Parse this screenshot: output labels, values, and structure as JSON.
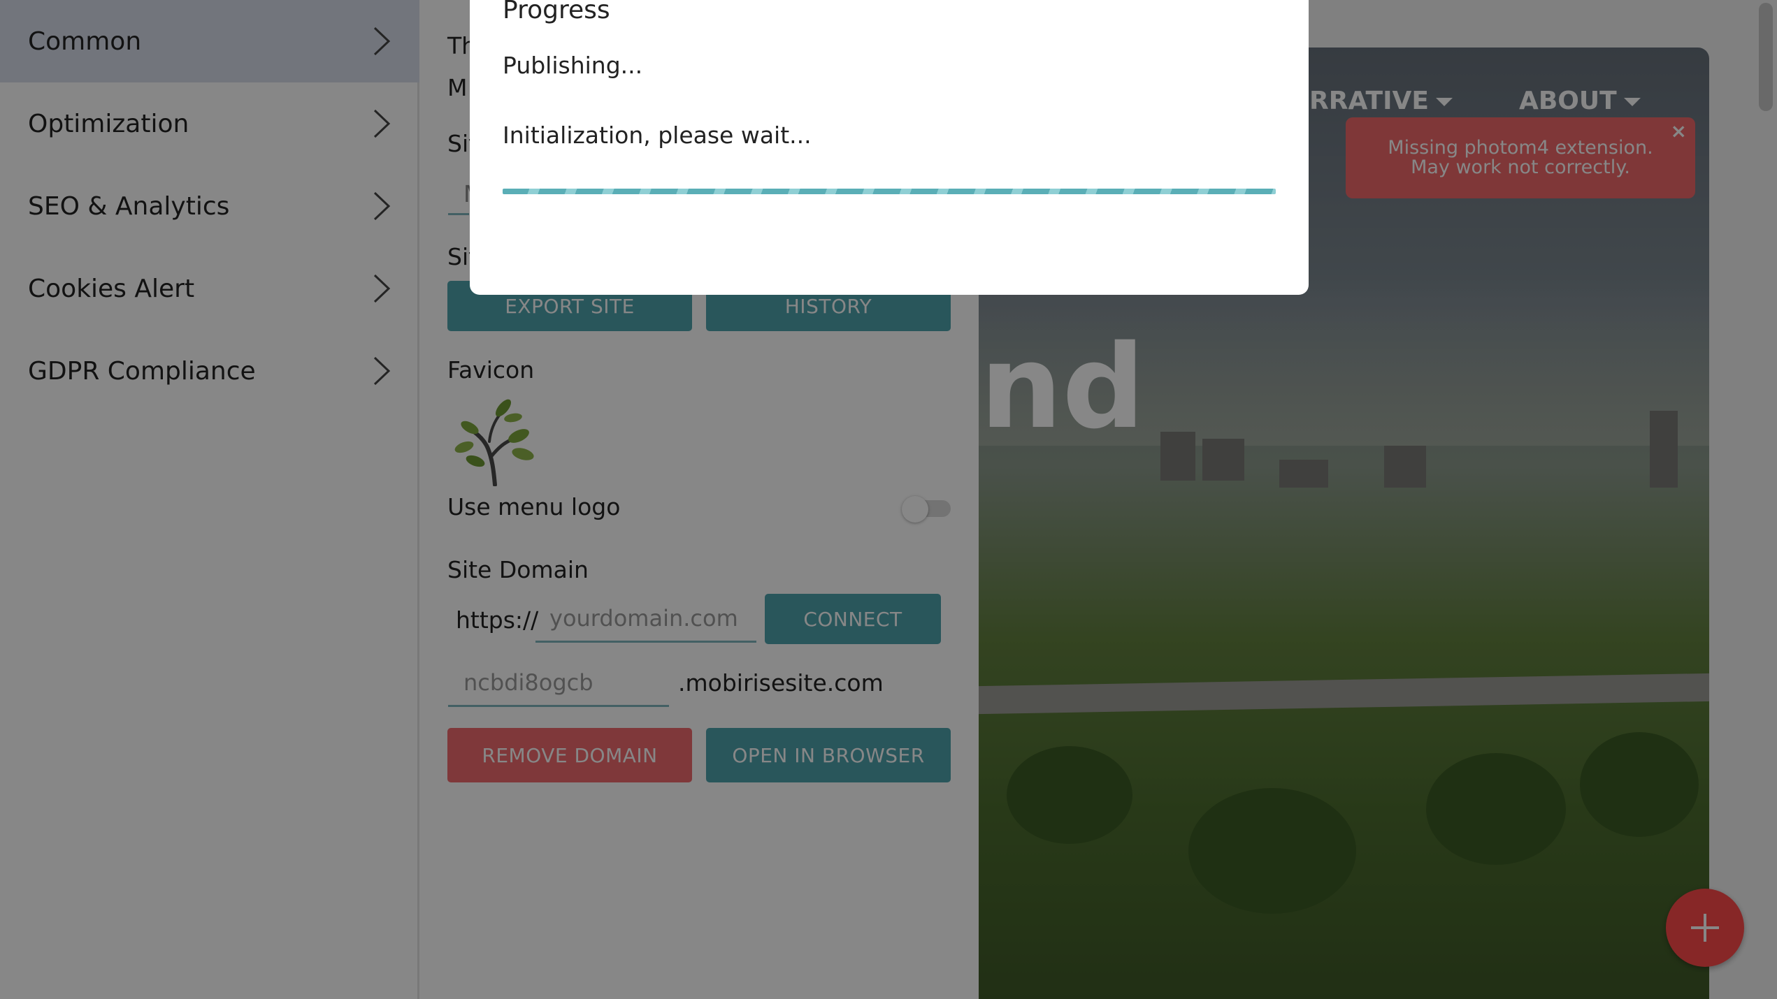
{
  "sidebar": {
    "items": [
      {
        "label": "Common",
        "icon": "chevron-right-icon"
      },
      {
        "label": "Optimization",
        "icon": "chevron-right-icon"
      },
      {
        "label": "SEO & Analytics",
        "icon": "chevron-right-icon"
      },
      {
        "label": "Cookies Alert",
        "icon": "chevron-right-icon"
      },
      {
        "label": "GDPR Compliance",
        "icon": "chevron-right-icon"
      }
    ]
  },
  "panel": {
    "partial_label_1": "Th",
    "partial_value_1": "M",
    "partial_label_2": "Sit",
    "partial_input_2": "M",
    "partial_label_3": "Sit",
    "export_button": "EXPORT SITE",
    "history_button": "HISTORY",
    "favicon_label": "Favicon",
    "favicon_icon": "tree-sapling-icon",
    "use_menu_logo_label": "Use menu logo",
    "use_menu_logo_on": false,
    "site_domain_label": "Site Domain",
    "protocol_prefix": "https://",
    "domain_placeholder": "yourdomain.com",
    "connect_button": "CONNECT",
    "subdomain_value": "ncbdi8ogcb",
    "subdomain_suffix": ".mobirisesite.com",
    "remove_domain_button": "REMOVE DOMAIN",
    "open_in_browser_button": "OPEN IN BROWSER"
  },
  "preview": {
    "nav_items": [
      "RRATIVE",
      "ABOUT"
    ],
    "hero_text_partial": "nd",
    "toast": {
      "message": "Missing photom4 extension. May work not correctly.",
      "close_label": "×"
    }
  },
  "modal": {
    "title": "Progress",
    "status": "Publishing...",
    "message": "Initialization, please wait..."
  },
  "colors": {
    "accent_teal": "#4ea2ad",
    "danger_red": "#f06b6f",
    "fab_red": "#ff4b4b",
    "active_sidebar": "#d7deea"
  }
}
